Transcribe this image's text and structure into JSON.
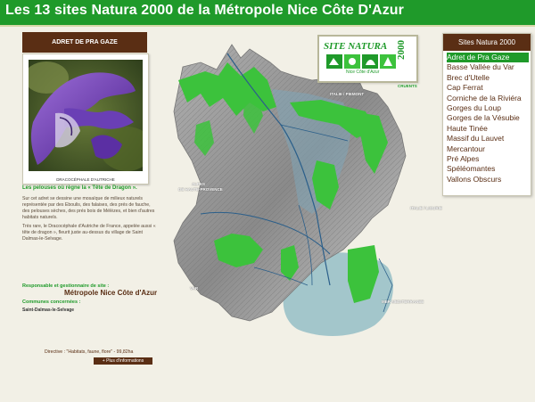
{
  "header": {
    "title": "Les 13 sites Natura 2000 de la Métropole Nice Côte D'Azur"
  },
  "site": {
    "name": "ADRET DE PRA GAZE",
    "photo_caption": "DRACOCÉPHALE D'AUTRICHE",
    "intro": "Les pelouses où règne la « Tête de Dragon ».",
    "description": "Sur cet adret se dessine une mosaïque de milieux naturels représentée par des Eboulis, des falaises, des prés de fauche, des pelouses sèches, des prés bois de Mélèzes, et bien d'autres habitats naturels.",
    "description2": "Très rare, le Dracocéphale d'Autriche de France, appelée aussi « tête de dragon », fleurit juste au-dessus du village de Saint Dalmas-le-Selvage.",
    "manager_label": "Responsable et gestionnaire de site :",
    "manager_value": "Métropole Nice Côte d'Azur",
    "communes_label": "Communes concernées :",
    "communes_value": "Saint-Dalmas-le-Selvage",
    "directive": "Directive : \"Habitats, faune, flore\" - 99,82ha",
    "more_button": "+ Plus d'informations"
  },
  "logo": {
    "title": "SITE NATURA",
    "number": "2000",
    "subtitle": "Nice Côte d'Azur"
  },
  "map_labels": {
    "italie_piemont": "ITALIE / PIEMONT",
    "alpes": "ALPES",
    "alpes2": "DE HAUTE-PROVENCE",
    "italie_ligurie": "ITALIE / LIGURIE",
    "var": "VAR",
    "mer": "MER MEDITERRANEE",
    "cruents": "CRUENTS"
  },
  "sites_panel": {
    "title": "Sites Natura 2000",
    "items": [
      {
        "label": "Adret de Pra Gaze",
        "active": true
      },
      {
        "label": "Basse Vallée du Var"
      },
      {
        "label": "Brec d'Utelle"
      },
      {
        "label": "Cap Ferrat"
      },
      {
        "label": "Corniche de la Riviéra"
      },
      {
        "label": "Gorges du Loup"
      },
      {
        "label": "Gorges de la Vésubie"
      },
      {
        "label": "Haute Tinée"
      },
      {
        "label": "Massif du Lauvet"
      },
      {
        "label": "Mercantour"
      },
      {
        "label": "Pré Alpes"
      },
      {
        "label": "Spéléomantes"
      },
      {
        "label": "Vallons Obscurs"
      }
    ]
  },
  "colors": {
    "header_green": "#1f9a2a",
    "brown": "#5a2e14",
    "natura_green": "#3cc23c",
    "sea_blue": "#8fbcc4"
  }
}
